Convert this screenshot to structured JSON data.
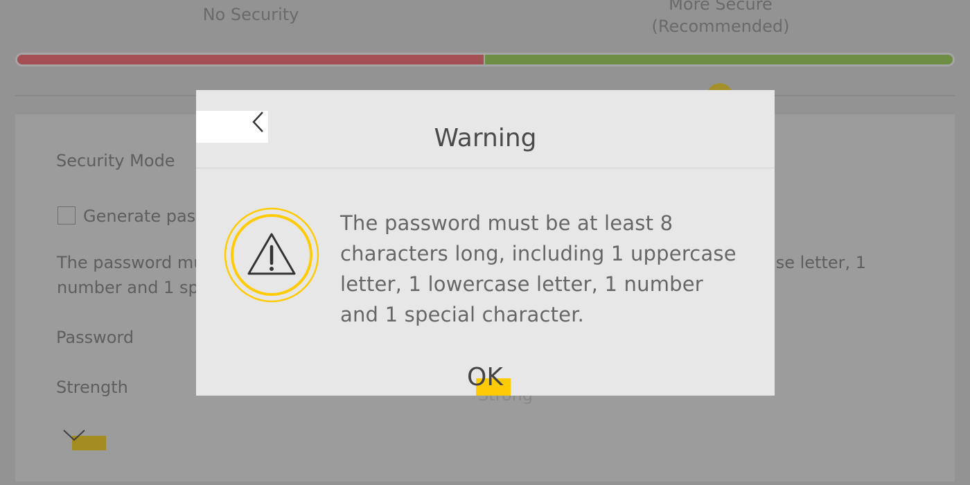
{
  "background": {
    "levels": {
      "left": "No Security",
      "right_line1": "More Secure",
      "right_line2": "(Recommended)"
    },
    "form": {
      "security_mode_label": "Security Mode",
      "generate_label": "Generate pas",
      "hint_line1_left": "The password mu",
      "hint_line2_left": "number and 1 sp",
      "hint_line1_right": "ase letter, 1",
      "password_label": "Password",
      "strength_label": "Strength",
      "strength_value": "Strong"
    },
    "colors": {
      "low": "#a34f53",
      "high": "#6f8e45",
      "accent": "#ffcb05"
    }
  },
  "dialog": {
    "title": "Warning",
    "back_icon": "chevron-left-icon",
    "alert_icon": "warning-triangle-icon",
    "message": "The password must be at least 8 characters long, including 1 uppercase letter, 1 lowercase letter, 1 number and 1 special character.",
    "ok_label": "OK"
  }
}
